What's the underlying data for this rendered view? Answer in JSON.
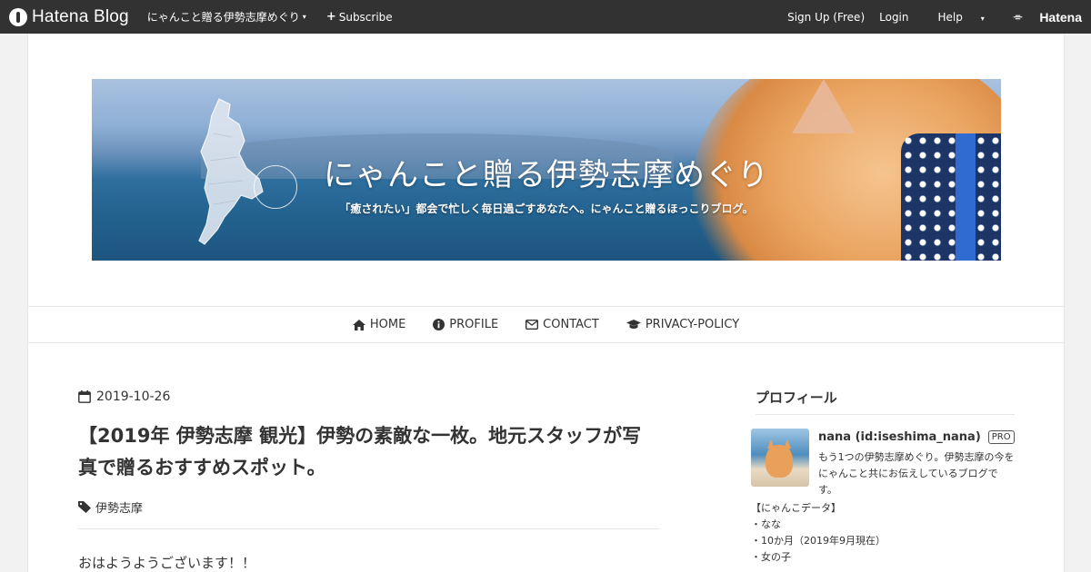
{
  "topbar": {
    "brand": "Hatena Blog",
    "blog_switch": "にゃんこと贈る伊勢志摩めぐり",
    "subscribe": "Subscribe",
    "signup": "Sign Up (Free)",
    "login": "Login",
    "help": "Help",
    "hatena": "Hatena",
    "background": "#323232"
  },
  "banner": {
    "title": "にゃんこと贈る伊勢志摩めぐり",
    "subtitle": "「癒されたい」都会で忙しく毎日過ごすあなたへ。にゃんこと贈るほっこりブログ。"
  },
  "nav": {
    "items": [
      {
        "label": "HOME",
        "icon": "home-icon"
      },
      {
        "label": "PROFILE",
        "icon": "info-circle-icon"
      },
      {
        "label": "CONTACT",
        "icon": "envelope-icon"
      },
      {
        "label": "PRIVACY-POLICY",
        "icon": "graduation-cap-icon"
      }
    ]
  },
  "article": {
    "date": "2019-10-26",
    "title": "【2019年 伊勢志摩 観光】伊勢の素敵な一枚。地元スタッフが写真で贈るおすすめスポット。",
    "category": "伊勢志摩",
    "greeting": "おはようようございます！！"
  },
  "sidebar": {
    "title": "プロフィール",
    "name": "nana (id:iseshima_nana)",
    "badge": "PRO",
    "description": "もう1つの伊勢志摩めぐり。伊勢志摩の今をにゃんこと共にお伝えしているブログです。",
    "lines": [
      "【にゃんこデータ】",
      "・なな",
      "・10か月（2019年9月現在）",
      "・女の子"
    ]
  }
}
